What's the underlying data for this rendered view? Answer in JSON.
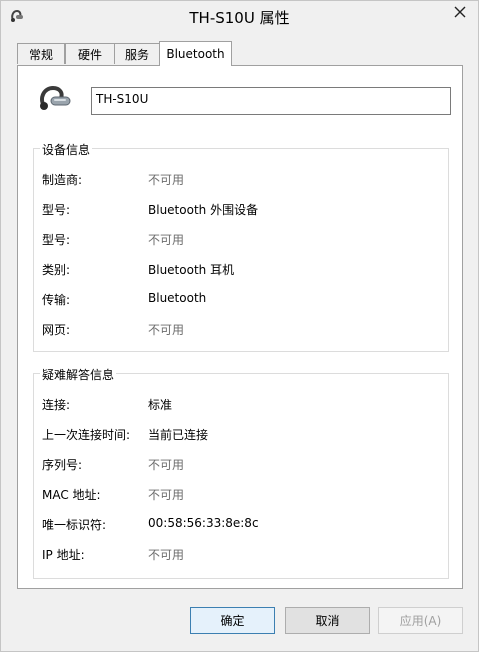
{
  "window": {
    "title": "TH-S10U 属性"
  },
  "tabs": [
    {
      "label": "常规"
    },
    {
      "label": "硬件"
    },
    {
      "label": "服务"
    },
    {
      "label": "Bluetooth"
    }
  ],
  "device": {
    "name": "TH-S10U"
  },
  "device_info": {
    "title": "设备信息",
    "rows": [
      {
        "label": "制造商:",
        "value": "不可用"
      },
      {
        "label": "型号:",
        "value": "Bluetooth 外围设备"
      },
      {
        "label": "型号:",
        "value": "不可用"
      },
      {
        "label": "类别:",
        "value": "Bluetooth 耳机"
      },
      {
        "label": "传输:",
        "value": "Bluetooth"
      },
      {
        "label": "网页:",
        "value": "不可用"
      }
    ]
  },
  "troubleshoot_info": {
    "title": "疑难解答信息",
    "rows": [
      {
        "label": "连接:",
        "value": "标准"
      },
      {
        "label": "上一次连接时间:",
        "value": "当前已连接"
      },
      {
        "label": "序列号:",
        "value": "不可用"
      },
      {
        "label": "MAC 地址:",
        "value": "不可用"
      },
      {
        "label": "唯一标识符:",
        "value": "00:58:56:33:8e:8c"
      },
      {
        "label": "IP 地址:",
        "value": "不可用"
      }
    ]
  },
  "buttons": {
    "ok": "确定",
    "cancel": "取消",
    "apply": "应用(A)"
  },
  "icons": {
    "title": "bluetooth-headset-icon",
    "close": "close-icon",
    "device": "headset-icon"
  }
}
